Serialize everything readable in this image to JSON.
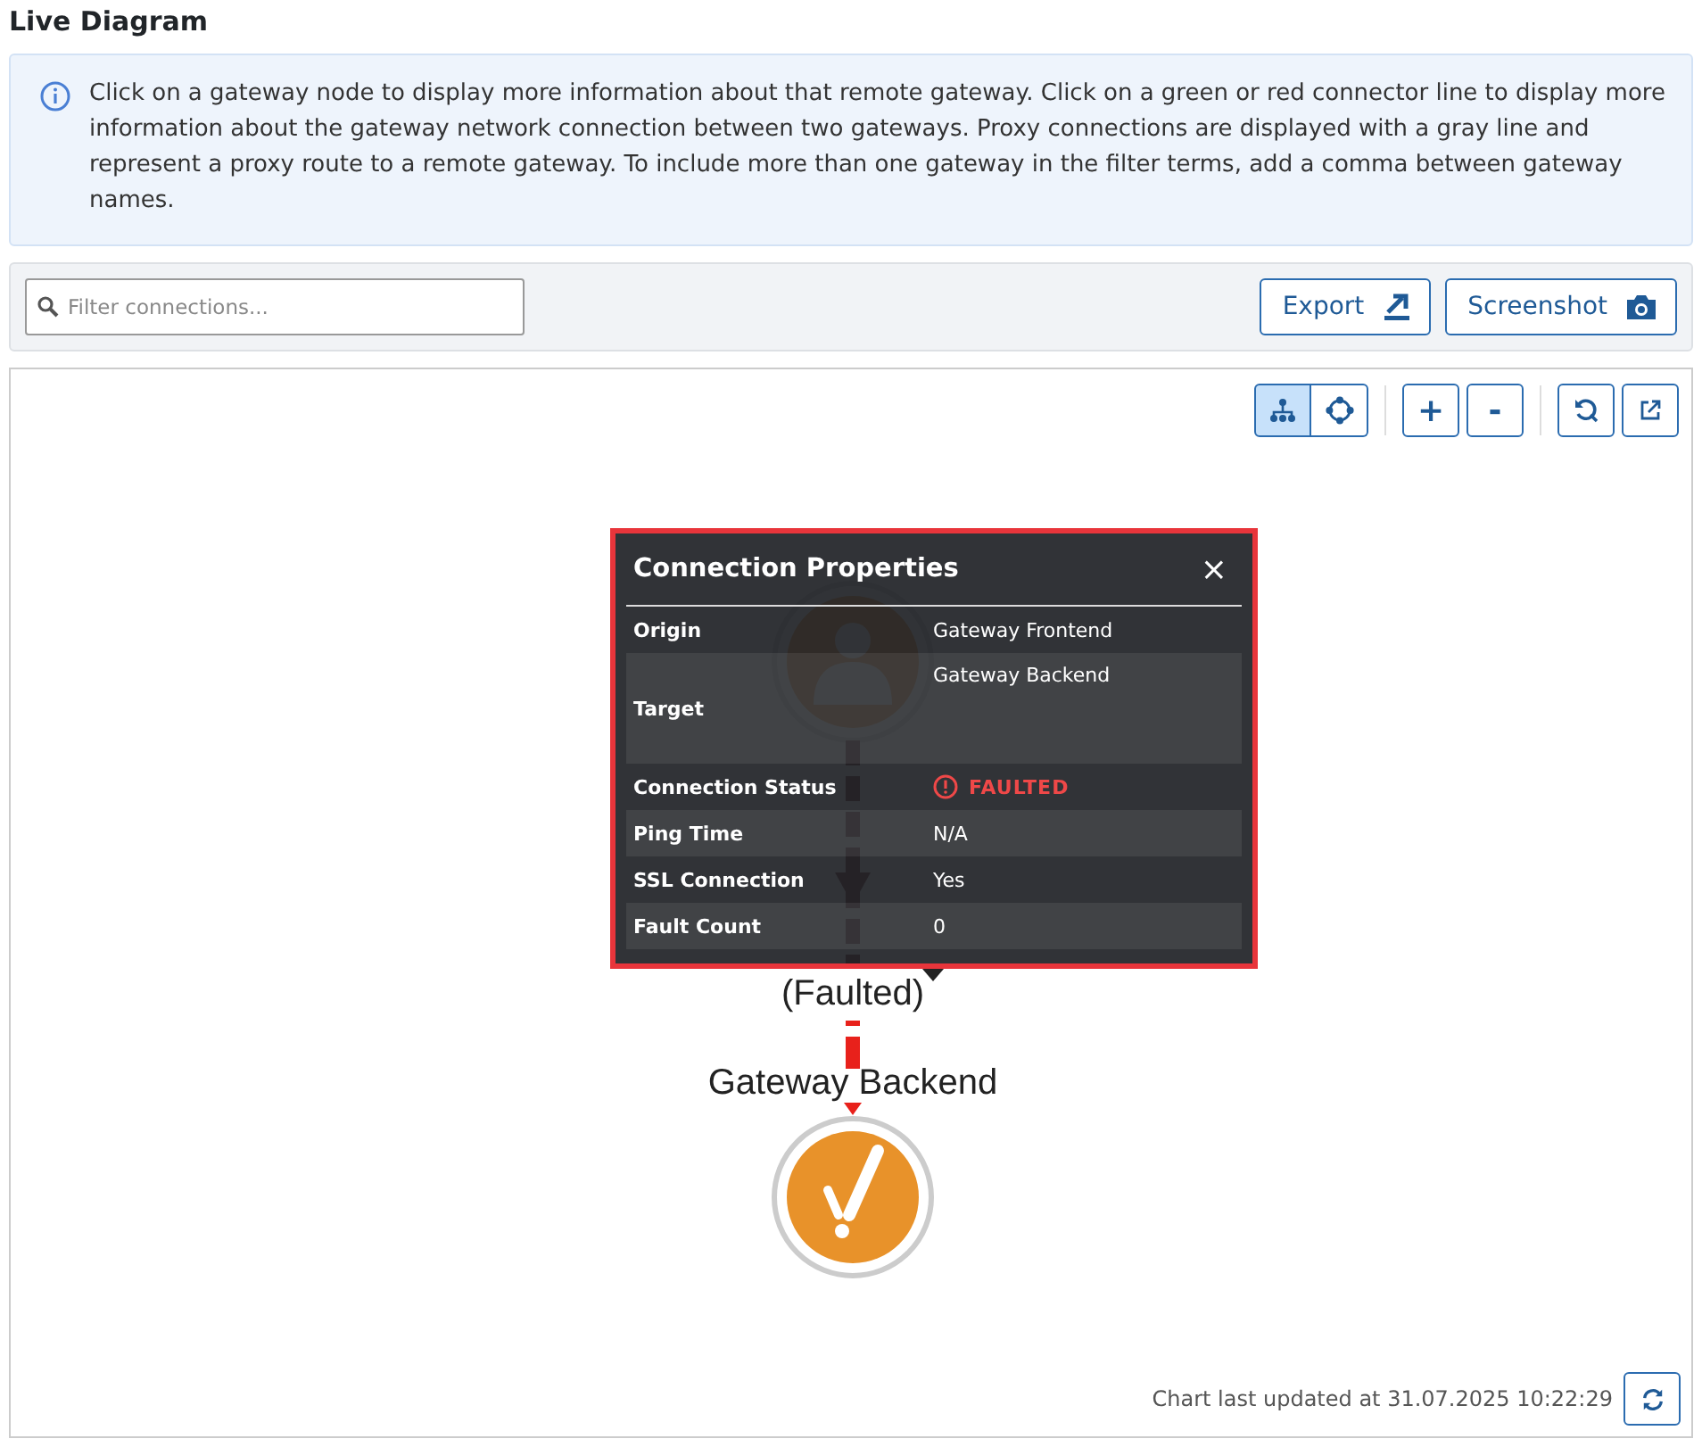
{
  "title": "Live Diagram",
  "info": "Click on a gateway node to display more information about that remote gateway. Click on a green or red connector line to display more information about the gateway network connection between two gateways. Proxy connections are displayed with a gray line and represent a proxy route to a remote gateway. To include more than one gateway in the filter terms, add a comma between gateway names.",
  "filter": {
    "placeholder": "Filter connections..."
  },
  "buttons": [
    {
      "label": "Export",
      "kind": "export"
    },
    {
      "label": "Screenshot",
      "kind": "screenshot"
    }
  ],
  "layout_modes": [
    {
      "kind": "tree",
      "selected": true
    },
    {
      "kind": "radial",
      "selected": false
    }
  ],
  "zoom_buttons": [
    "+",
    "-"
  ],
  "nodes": [
    {
      "kind": "person"
    },
    {
      "label": "Gateway Backend",
      "kind": "fault"
    }
  ],
  "connection": {
    "label": "(Faulted)",
    "kind": "faulted"
  },
  "popup": {
    "title": "Connection Properties",
    "close": "×",
    "rows": [
      {
        "label": "Origin",
        "value": "Gateway Frontend",
        "kind": "text"
      },
      {
        "label": "Target",
        "value": "Gateway Backend",
        "kind": "tall"
      },
      {
        "label": "Connection Status",
        "value": "FAULTED",
        "kind": "status"
      },
      {
        "label": "Ping Time",
        "value": "N/A",
        "kind": "text"
      },
      {
        "label": "SSL Connection",
        "value": "Yes",
        "kind": "text"
      },
      {
        "label": "Fault Count",
        "value": "0",
        "kind": "text"
      }
    ]
  },
  "footer": "Chart last updated at 31.07.2025 10:22:29"
}
